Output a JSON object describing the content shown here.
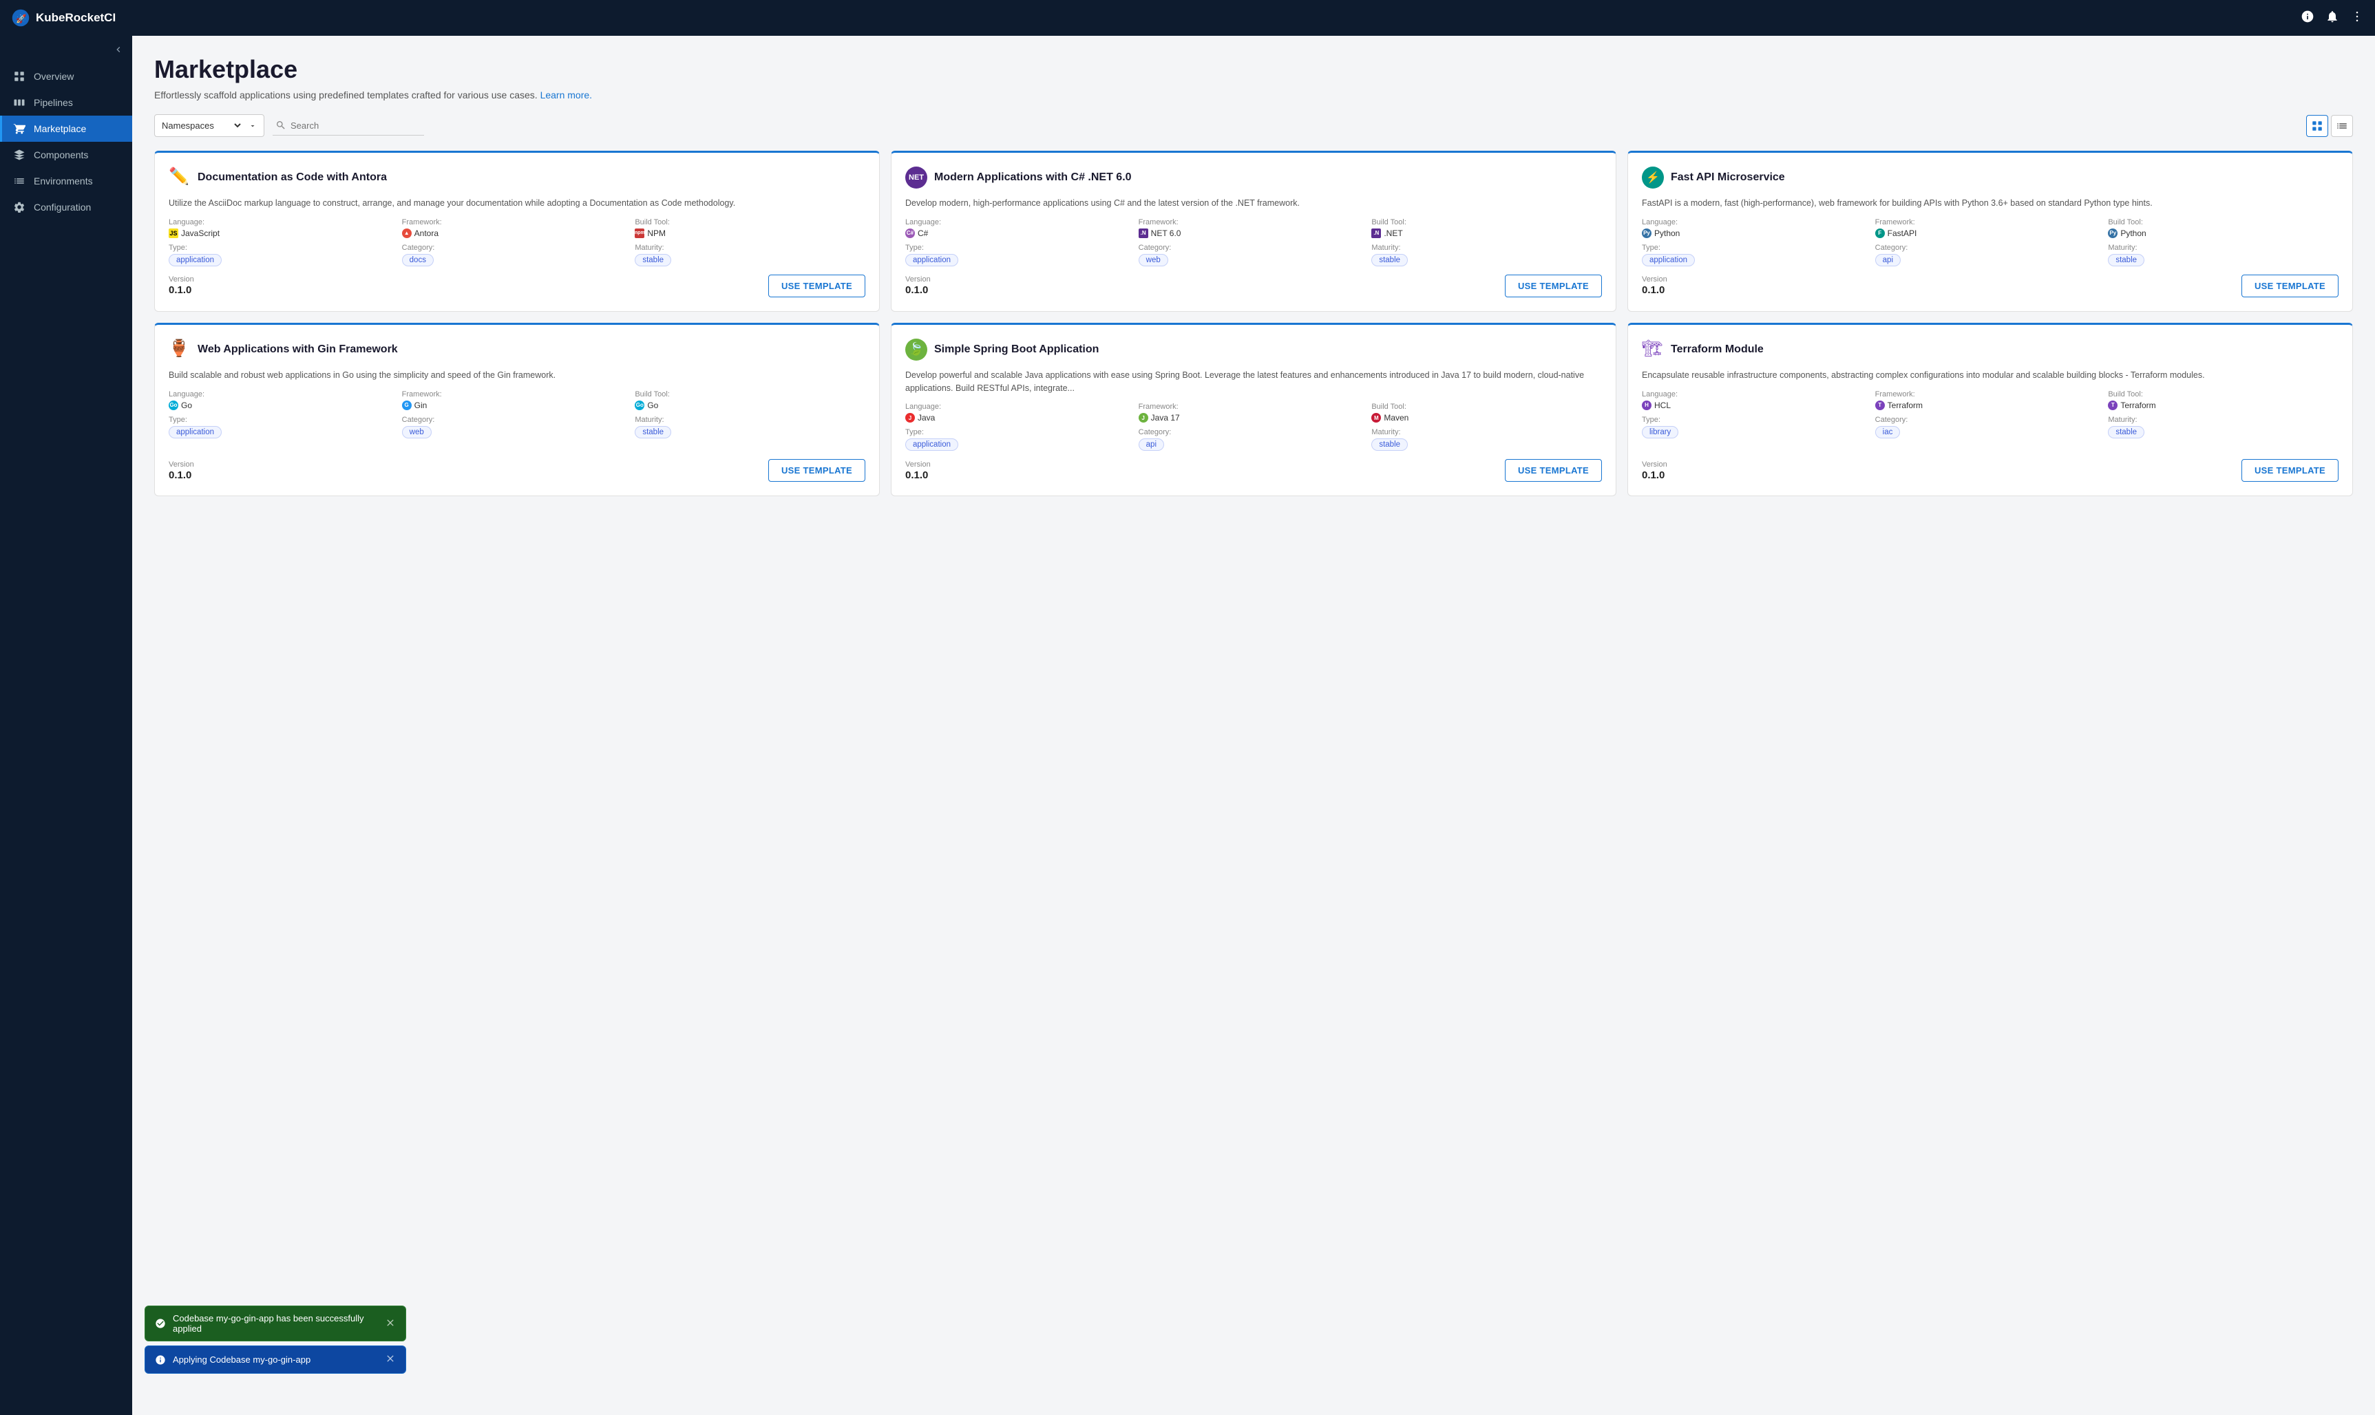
{
  "app": {
    "name": "KubeRocketCI"
  },
  "topnav": {
    "logo_text": "KubeRocketCI",
    "info_icon": "info-circle",
    "bell_icon": "bell",
    "menu_icon": "ellipsis-vertical"
  },
  "sidebar": {
    "collapse_icon": "chevron-left",
    "items": [
      {
        "id": "overview",
        "label": "Overview",
        "icon": "grid"
      },
      {
        "id": "pipelines",
        "label": "Pipelines",
        "icon": "pipelines"
      },
      {
        "id": "marketplace",
        "label": "Marketplace",
        "icon": "cart",
        "active": true
      },
      {
        "id": "components",
        "label": "Components",
        "icon": "layers"
      },
      {
        "id": "environments",
        "label": "Environments",
        "icon": "list"
      },
      {
        "id": "configuration",
        "label": "Configuration",
        "icon": "gear"
      }
    ]
  },
  "page": {
    "title": "Marketplace",
    "subtitle": "Effortlessly scaffold applications using predefined templates crafted for various use cases.",
    "learn_more": "Learn more."
  },
  "toolbar": {
    "namespace_label": "Namespaces",
    "search_placeholder": "Search",
    "view_grid_label": "Grid view",
    "view_list_label": "List view"
  },
  "cards": [
    {
      "id": "doc-antora",
      "icon": "✏️",
      "title": "Documentation as Code with Antora",
      "description": "Utilize the AsciiDoc markup language to construct, arrange, and manage your documentation while adopting a Documentation as Code methodology.",
      "language": "JavaScript",
      "language_icon": "js",
      "framework": "Antora",
      "framework_icon": "antora",
      "build_tool": "NPM",
      "build_tool_icon": "npm",
      "type": "application",
      "category": "docs",
      "maturity": "stable",
      "version_label": "Version",
      "version": "0.1.0",
      "button_label": "USE TEMPLATE"
    },
    {
      "id": "dotnet-modern",
      "icon": "NET",
      "icon_bg": "#5c2d91",
      "title": "Modern Applications with C# .NET 6.0",
      "description": "Develop modern, high-performance applications using C# and the latest version of the .NET framework.",
      "language": "C#",
      "language_icon": "csharp",
      "framework": "NET 6.0",
      "framework_icon": "net",
      "build_tool": ".NET",
      "build_tool_icon": "net",
      "type": "application",
      "category": "web",
      "maturity": "stable",
      "version_label": "Version",
      "version": "0.1.0",
      "button_label": "USE TEMPLATE"
    },
    {
      "id": "fastapi",
      "icon": "⚡",
      "icon_bg": "#009688",
      "title": "Fast API Microservice",
      "description": "FastAPI is a modern, fast (high-performance), web framework for building APIs with Python 3.6+ based on standard Python type hints.",
      "language": "Python",
      "language_icon": "python",
      "framework": "FastAPI",
      "framework_icon": "fastapi",
      "build_tool": "Python",
      "build_tool_icon": "python",
      "type": "application",
      "category": "api",
      "maturity": "stable",
      "version_label": "Version",
      "version": "0.1.0",
      "button_label": "USE TEMPLATE"
    },
    {
      "id": "gin-web",
      "icon": "🏺",
      "title": "Web Applications with Gin Framework",
      "description": "Build scalable and robust web applications in Go using the simplicity and speed of the Gin framework.",
      "language": "Go",
      "language_icon": "go",
      "framework": "Gin",
      "framework_icon": "gin",
      "build_tool": "Go",
      "build_tool_icon": "go",
      "type": "application",
      "category": "web",
      "maturity": "stable",
      "version_label": "Version",
      "version": "0.1.0",
      "button_label": "USE TEMPLATE"
    },
    {
      "id": "spring-boot",
      "icon": "🍃",
      "title": "Simple Spring Boot Application",
      "description": "Develop powerful and scalable Java applications with ease using Spring Boot. Leverage the latest features and enhancements introduced in Java 17 to build modern, cloud-native applications. Build RESTful APIs, integrate...",
      "language": "Java",
      "language_icon": "java",
      "framework": "Java 17",
      "framework_icon": "spring",
      "build_tool": "Maven",
      "build_tool_icon": "maven",
      "type": "application",
      "category": "api",
      "maturity": "stable",
      "version_label": "Version",
      "version": "0.1.0",
      "button_label": "USE TEMPLATE"
    },
    {
      "id": "terraform",
      "icon": "🏗",
      "title": "Terraform Module",
      "description": "Encapsulate reusable infrastructure components, abstracting complex configurations into modular and scalable building blocks - Terraform modules.",
      "language": "HCL",
      "language_icon": "hcl",
      "framework": "Terraform",
      "framework_icon": "terraform",
      "build_tool": "Terraform",
      "build_tool_icon": "terraform",
      "type": "library",
      "category": "iac",
      "maturity": "stable",
      "version_label": "Version",
      "version": "0.1.0",
      "button_label": "USE TEMPLATE"
    }
  ],
  "toasts": [
    {
      "id": "toast-success",
      "type": "success",
      "message": "Codebase my-go-gin-app has been successfully applied",
      "icon": "check-circle"
    },
    {
      "id": "toast-info",
      "type": "info",
      "message": "Applying Codebase my-go-gin-app",
      "icon": "info-circle"
    }
  ]
}
